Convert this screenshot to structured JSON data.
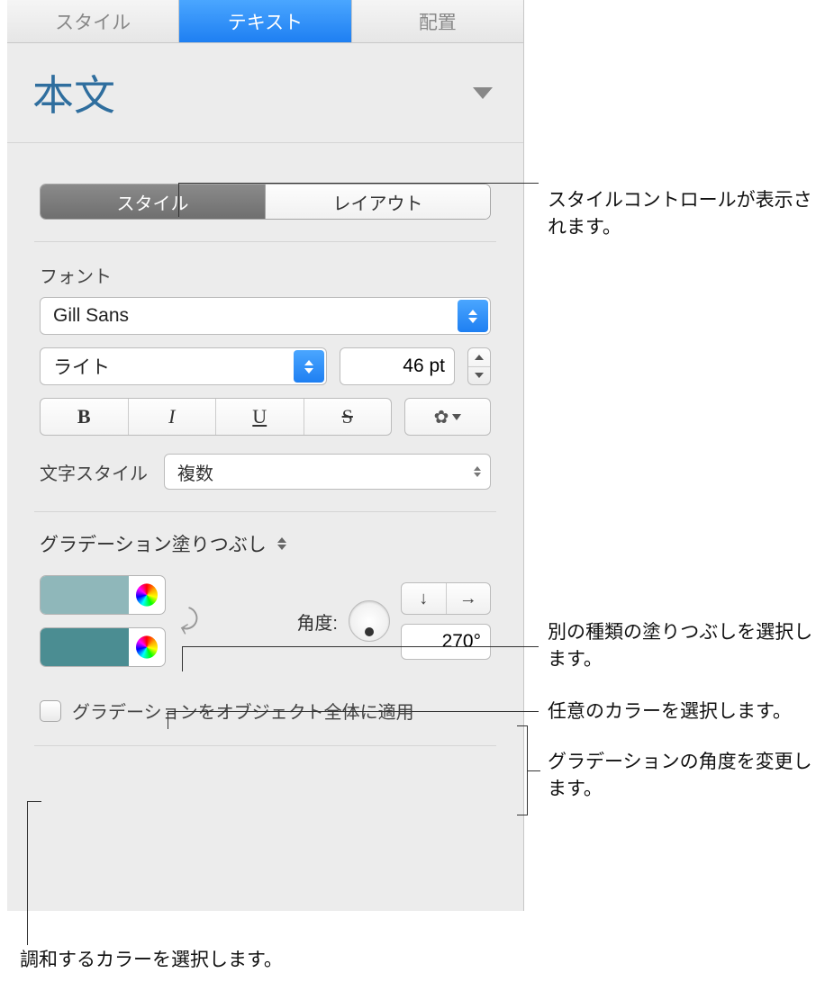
{
  "top_tabs": {
    "style": "スタイル",
    "text": "テキスト",
    "arrange": "配置"
  },
  "paragraph_style": "本文",
  "segmented": {
    "style": "スタイル",
    "layout": "レイアウト"
  },
  "font": {
    "section_label": "フォント",
    "family": "Gill Sans",
    "weight": "ライト",
    "size": "46 pt",
    "char_style_label": "文字スタイル",
    "char_style_value": "複数"
  },
  "fill": {
    "type_label": "グラデーション塗りつぶし",
    "angle_label": "角度:",
    "angle_value": "270°",
    "color1": "#8fb7ba",
    "color2": "#4b8d92",
    "apply_label": "グラデーションをオブジェクト全体に適用"
  },
  "callouts": {
    "style_controls": "スタイルコントロールが表示されます。",
    "fill_type": "別の種類の塗りつぶしを選択します。",
    "any_color": "任意のカラーを選択します。",
    "angle": "グラデーションの角度を変更します。",
    "matching_color": "調和するカラーを選択します。"
  }
}
